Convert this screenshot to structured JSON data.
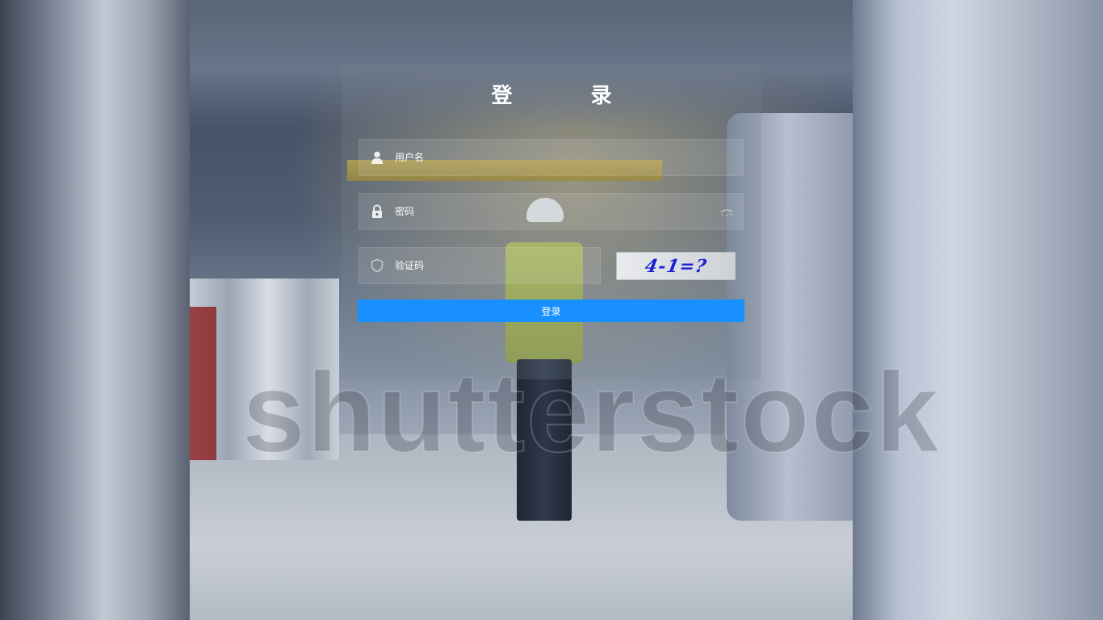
{
  "page": {
    "title": "登录"
  },
  "login": {
    "title": "登 录",
    "username": {
      "placeholder": "用户名",
      "value": ""
    },
    "password": {
      "placeholder": "密码",
      "value": ""
    },
    "captcha": {
      "placeholder": "验证码",
      "value": "",
      "image_text": "4-1=?"
    },
    "submit_label": "登录",
    "accent_color": "#1890ff"
  },
  "background": {
    "watermark": "shutterstock"
  },
  "icons": {
    "username": "user-icon",
    "password": "lock-icon",
    "captcha": "shield-icon",
    "password_toggle": "eye-icon"
  }
}
